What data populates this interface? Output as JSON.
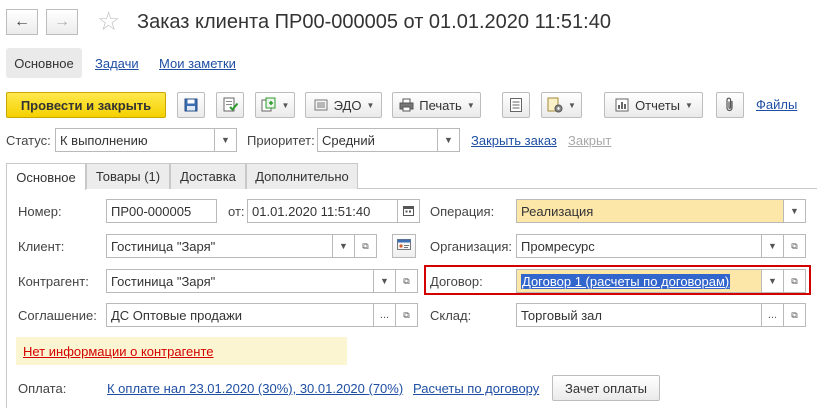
{
  "window": {
    "title": "Заказ клиента ПР00-000005 от 01.01.2020 11:51:40",
    "back_icon": "arrow-left-icon",
    "forward_icon": "arrow-right-icon",
    "favorite_icon": "star-icon"
  },
  "top_tabs": [
    {
      "label": "Основное",
      "active": true
    },
    {
      "label": "Задачи",
      "active": false
    },
    {
      "label": "Мои заметки",
      "active": false
    }
  ],
  "toolbar": {
    "post_and_close": "Провести и закрыть",
    "edo": "ЭДО",
    "print": "Печать",
    "reports": "Отчеты",
    "files": "Файлы"
  },
  "status_row": {
    "status_label": "Статус:",
    "status_value": "К выполнению",
    "priority_label": "Приоритет:",
    "priority_value": "Средний",
    "close_order": "Закрыть заказ",
    "closed": "Закрыт"
  },
  "inner_tabs": [
    {
      "label": "Основное",
      "active": true
    },
    {
      "label": "Товары (1)",
      "active": false
    },
    {
      "label": "Доставка",
      "active": false
    },
    {
      "label": "Дополнительно",
      "active": false
    }
  ],
  "form": {
    "number_label": "Номер:",
    "number_value": "ПР00-000005",
    "date_label": "от:",
    "date_value": "01.01.2020 11:51:40",
    "operation_label": "Операция:",
    "operation_value": "Реализация",
    "client_label": "Клиент:",
    "client_value": "Гостиница \"Заря\"",
    "organization_label": "Организация:",
    "organization_value": "Промресурс",
    "counterparty_label": "Контрагент:",
    "counterparty_value": "Гостиница \"Заря\"",
    "contract_label": "Договор:",
    "contract_value": "Договор 1 (расчеты по договорам)",
    "agreement_label": "Соглашение:",
    "agreement_value": "ДС Оптовые продажи",
    "warehouse_label": "Склад:",
    "warehouse_value": "Торговый зал",
    "no_info_link": "Нет информации о контрагенте",
    "payment_label": "Оплата:",
    "payment_link": "К оплате нал 23.01.2020 (30%), 30.01.2020 (70%)",
    "contract_settlements_link": "Расчеты по договору",
    "offset_payment": "Зачет оплаты",
    "ellipsis": "...",
    "open_glyph": "⧉"
  },
  "colors": {
    "primary_button": "#f5d100",
    "operation_field": "#fde7a8",
    "highlight_border": "#d40000",
    "info_panel": "#fcf5d2",
    "link": "#1f4fa3"
  }
}
